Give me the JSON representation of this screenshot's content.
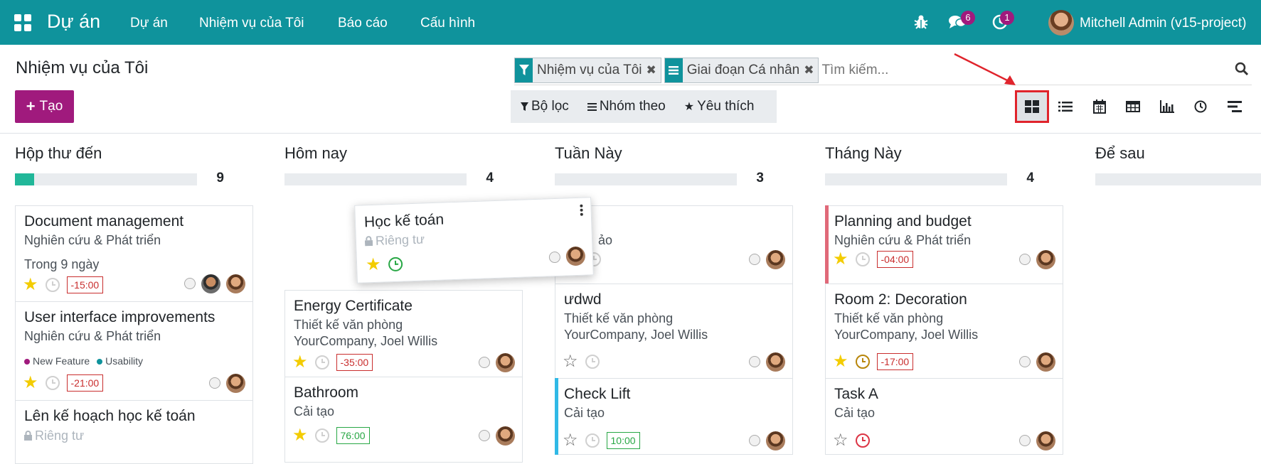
{
  "navbar": {
    "brand": "Dự án",
    "menu": [
      "Dự án",
      "Nhiệm vụ của Tôi",
      "Báo cáo",
      "Cấu hình"
    ],
    "messages_badge": "6",
    "activities_badge": "1",
    "user_name": "Mitchell Admin (v15-project)"
  },
  "control": {
    "title": "Nhiệm vụ của Tôi",
    "create_label": "Tạo",
    "facets": [
      "Nhiệm vụ của Tôi",
      "Giai đoạn Cá nhân"
    ],
    "search_placeholder": "Tìm kiếm...",
    "filters_label": "Bộ lọc",
    "group_by_label": "Nhóm theo",
    "favorites_label": "Yêu thích",
    "views": [
      "kanban-icon",
      "list-icon",
      "calendar-icon",
      "pivot-icon",
      "graph-icon",
      "activity-icon",
      "gantt-icon"
    ],
    "active_view": "kanban"
  },
  "columns": [
    {
      "title": "Hộp thư đến",
      "count": "9",
      "progress_fraction": 0.09,
      "progress_color": "#21b799",
      "cards": [
        {
          "title": "Document management",
          "subtitle": "Nghiên cứu & Phát triển",
          "extra": "Trong 9 ngày",
          "date": "-15:00",
          "date_style": "red",
          "starred": true,
          "clock": "grey",
          "avatars": 2
        },
        {
          "title": "User interface improvements",
          "subtitle": "Nghiên cứu & Phát triển",
          "tags": [
            {
              "name": "New Feature",
              "color": "#a01a7d"
            },
            {
              "name": "Usability",
              "color": "#0f939c"
            }
          ],
          "date": "-21:00",
          "date_style": "red",
          "starred": true,
          "clock": "grey",
          "avatars": 1
        },
        {
          "title": "Lên kế hoạch học kế toán",
          "muted": "Riêng tư"
        }
      ]
    },
    {
      "title": "Hôm nay",
      "count": "4",
      "progress_fraction": 0,
      "cards": [
        {
          "title": "Energy Certificate",
          "subtitle": "Thiết kế văn phòng",
          "subtitle2": "YourCompany, Joel Willis",
          "date": "-35:00",
          "date_style": "red",
          "starred": true,
          "clock": "grey",
          "avatars": 1
        },
        {
          "title": "Bathroom",
          "subtitle": "Cải tạo",
          "date": "76:00",
          "date_style": "green",
          "starred": true,
          "clock": "grey",
          "avatars": 1
        }
      ]
    },
    {
      "title": "Tuần Này",
      "count": "3",
      "progress_fraction": 0,
      "cards": [
        {
          "title": "",
          "subtitle": "ảo",
          "clock": "grey",
          "avatars": 1
        },
        {
          "title": "ưdwd",
          "subtitle": "Thiết kế văn phòng",
          "subtitle2": "YourCompany, Joel Willis",
          "starred": false,
          "clock": "grey",
          "avatars": 1
        },
        {
          "title": "Check Lift",
          "subtitle": "Cải tạo",
          "date": "10:00",
          "date_style": "green",
          "starred": false,
          "clock": "grey",
          "avatars": 1,
          "border": "#30b9e6"
        }
      ]
    },
    {
      "title": "Tháng Này",
      "count": "4",
      "progress_fraction": 0,
      "cards": [
        {
          "title": "Planning and budget",
          "subtitle": "Nghiên cứu & Phát triển",
          "date": "-04:00",
          "date_style": "red",
          "starred": true,
          "clock": "grey",
          "avatars": 1,
          "border": "#e06979"
        },
        {
          "title": "Room 2: Decoration",
          "subtitle": "Thiết kế văn phòng",
          "subtitle2": "YourCompany, Joel Willis",
          "date": "-17:00",
          "date_style": "red",
          "starred": true,
          "clock": "orange",
          "avatars": 1
        },
        {
          "title": "Task A",
          "subtitle": "Cải tạo",
          "starred": false,
          "clock": "red",
          "avatars": 1
        }
      ]
    },
    {
      "title": "Để sau",
      "count": "",
      "progress_fraction": 0,
      "cards": []
    }
  ],
  "dragging_card": {
    "title": "Học kế toán",
    "muted": "Riêng tư",
    "starred": true,
    "clock": "green"
  }
}
